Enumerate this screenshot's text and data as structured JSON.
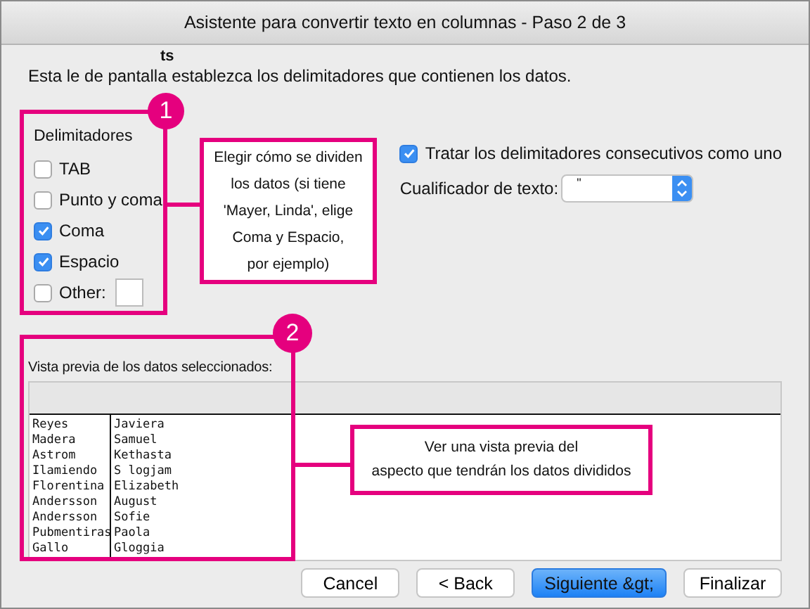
{
  "window": {
    "title": "Asistente para convertir texto en columnas - Paso 2 de 3"
  },
  "instruction": "Esta le de pantalla establezca los delimitadores que contienen los datos.",
  "overlay_fragment": "ts",
  "delimiters": {
    "title": "Delimitadores",
    "options": [
      {
        "label": "TAB",
        "checked": false,
        "kind": "plain"
      },
      {
        "label": "Punto y coma",
        "checked": false,
        "kind": "plain"
      },
      {
        "label": "Coma",
        "checked": true,
        "kind": "plain"
      },
      {
        "label": "Espacio",
        "checked": true,
        "kind": "plain"
      },
      {
        "label": "Other:",
        "checked": false,
        "kind": "with-field"
      }
    ]
  },
  "consecutive": {
    "label": "Tratar los delimitadores consecutivos como uno",
    "checked": true
  },
  "qualifier": {
    "label": "Cualificador de texto:",
    "value": "\""
  },
  "preview": {
    "label": "Vista previa de los datos seleccionados:",
    "rows": [
      [
        "Reyes",
        "Javiera"
      ],
      [
        "Madera",
        "Samuel"
      ],
      [
        "Astrom",
        "Kethasta"
      ],
      [
        "Ilamiendo",
        "S logjam"
      ],
      [
        "Florentina",
        "Elizabeth"
      ],
      [
        "Andersson",
        "August"
      ],
      [
        "Andersson",
        "Sofie"
      ],
      [
        "Pubmentiras",
        "Paola"
      ],
      [
        "Gallo",
        "Gloggia"
      ]
    ]
  },
  "callouts": [
    {
      "number": "1",
      "text": "Elegir cómo se dividen\nlos datos (si tiene\n'Mayer, Linda', elige\nComa y Espacio,\npor ejemplo)"
    },
    {
      "number": "2",
      "text": "Ver una vista previa del\naspecto que tendrán los datos divididos"
    }
  ],
  "buttons": [
    {
      "label": "Cancel",
      "kind": "default"
    },
    {
      "label": "< Back",
      "kind": "default"
    },
    {
      "label": "Siguiente &gt;",
      "kind": "primary"
    },
    {
      "label": "Finalizar",
      "kind": "default"
    }
  ]
}
